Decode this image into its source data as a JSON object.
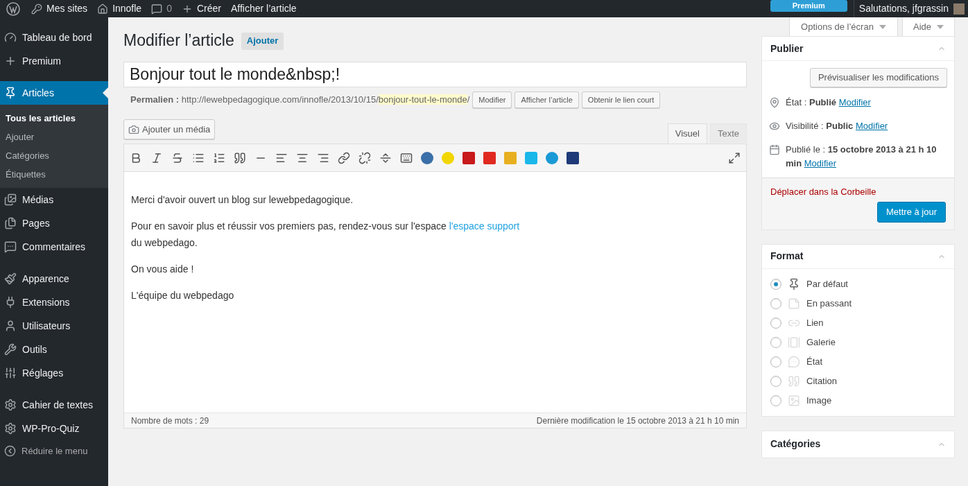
{
  "admin_bar": {
    "items": [
      {
        "kind": "sites",
        "label": "Mes sites"
      },
      {
        "kind": "home",
        "label": "Innofle"
      },
      {
        "kind": "comments",
        "label": "0"
      },
      {
        "kind": "new",
        "label": "Créer"
      },
      {
        "kind": "plain",
        "label": "Afficher l’article"
      }
    ],
    "premium": "Premium",
    "greeting": "Salutations, jfgrassin"
  },
  "sidebar": {
    "groups": [
      [
        {
          "kind": "dashboard",
          "label": "Tableau de bord",
          "selected": false
        },
        {
          "kind": "plus",
          "label": "Premium",
          "selected": false
        }
      ],
      [
        {
          "kind": "pin",
          "label": "Articles",
          "selected": true,
          "children": [
            {
              "label": "Tous les articles",
              "selected": true
            },
            {
              "label": "Ajouter",
              "selected": false
            },
            {
              "label": "Catégories",
              "selected": false
            },
            {
              "label": "Étiquettes",
              "selected": false
            }
          ]
        },
        {
          "kind": "media",
          "label": "Médias",
          "selected": false
        },
        {
          "kind": "pages",
          "label": "Pages",
          "selected": false
        },
        {
          "kind": "comment",
          "label": "Commentaires",
          "selected": false
        }
      ],
      [
        {
          "kind": "brush",
          "label": "Apparence",
          "selected": false
        },
        {
          "kind": "plug",
          "label": "Extensions",
          "selected": false
        },
        {
          "kind": "user",
          "label": "Utilisateurs",
          "selected": false
        },
        {
          "kind": "wrench",
          "label": "Outils",
          "selected": false
        },
        {
          "kind": "sliders",
          "label": "Réglages",
          "selected": false
        }
      ],
      [
        {
          "kind": "gear",
          "label": "Cahier de textes",
          "selected": false
        },
        {
          "kind": "gear",
          "label": "WP-Pro-Quiz",
          "selected": false
        }
      ]
    ],
    "collapse": "Réduire le menu"
  },
  "screen_options": [
    "Options de l’écran",
    "Aide"
  ],
  "page": {
    "title": "Modifier l’article",
    "add_button": "Ajouter"
  },
  "post": {
    "title": "Bonjour tout le monde&nbsp;!",
    "permalink_label": "Permalien :",
    "permalink_base": "http://lewebpedagogique.com/innofle/2013/10/15/",
    "permalink_slug": "bonjour-tout-le-monde",
    "permalink_end": "/",
    "permalink_buttons": [
      "Modifier",
      "Afficher l’article",
      "Obtenir le lien court"
    ]
  },
  "editor": {
    "media_button": "Ajouter un média",
    "tabs": [
      {
        "label": "Visuel",
        "selected": true
      },
      {
        "label": "Texte",
        "selected": false
      }
    ],
    "paragraphs": [
      {
        "text": "Merci d'avoir ouvert un blog sur lewebpedagogique."
      },
      {
        "text": "Pour en savoir plus et réussir vos premiers pas, rendez-vous sur l'espace ",
        "link": "l'espace support",
        "after": "du webpedago."
      },
      {
        "text": "On vous aide !"
      },
      {
        "text": "L'équipe du webpedago"
      }
    ],
    "word_count": "Nombre de mots : 29",
    "last_modified": "Dernière modification le 15 octobre 2013 à 21 h 10 min"
  },
  "publish": {
    "title": "Publier",
    "preview_button": "Prévisualiser les modifications",
    "rows": [
      {
        "kind": "pin",
        "label": "État :",
        "value": "Publié",
        "link": "Modifier"
      },
      {
        "kind": "eye",
        "label": "Visibilité :",
        "value": "Public",
        "link": "Modifier"
      },
      {
        "kind": "calendar",
        "label": "Publié le :",
        "value": "15 octobre 2013 à 21 h 10 min",
        "link": "Modifier"
      }
    ],
    "trash": "Déplacer dans la Corbeille",
    "update_button": "Mettre à jour"
  },
  "format": {
    "title": "Format",
    "options": [
      {
        "kind": "pin",
        "label": "Par défaut",
        "selected": true
      },
      {
        "kind": "note",
        "label": "En passant",
        "selected": false
      },
      {
        "kind": "link",
        "label": "Lien",
        "selected": false
      },
      {
        "kind": "gallery",
        "label": "Galerie",
        "selected": false
      },
      {
        "kind": "chat",
        "label": "État",
        "selected": false
      },
      {
        "kind": "quote",
        "label": "Citation",
        "selected": false
      },
      {
        "kind": "image",
        "label": "Image",
        "selected": false
      }
    ]
  },
  "categories": {
    "title": "Catégories"
  }
}
